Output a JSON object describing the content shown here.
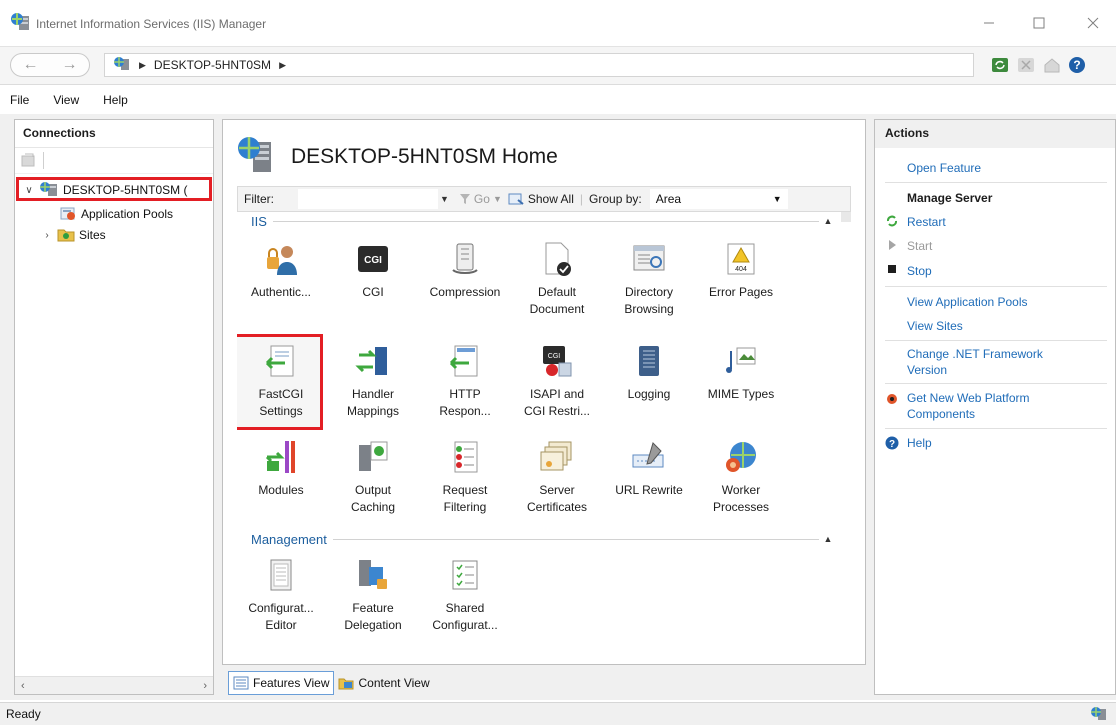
{
  "window": {
    "title": "Internet Information Services (IIS) Manager"
  },
  "address_bar": {
    "crumbs": [
      "DESKTOP-5HNT0SM"
    ]
  },
  "menu": [
    "File",
    "View",
    "Help"
  ],
  "connections": {
    "header": "Connections",
    "tree": [
      {
        "label": "DESKTOP-5HNT0SM (",
        "expanded": true,
        "icon": "server-icon"
      },
      {
        "label": "Application Pools",
        "icon": "app-pools-icon"
      },
      {
        "label": "Sites",
        "expanded": false,
        "icon": "sites-icon"
      }
    ]
  },
  "home": {
    "title": "DESKTOP-5HNT0SM Home"
  },
  "filter": {
    "label": "Filter:",
    "go": "Go",
    "show_all": "Show All",
    "group_by": "Group by:",
    "group_value": "Area"
  },
  "groups": {
    "iis": "IIS",
    "management": "Management"
  },
  "features_iis": [
    [
      "Authentic...",
      "CGI",
      "Compression",
      "Default\nDocument",
      "Directory\nBrowsing",
      "Error Pages"
    ],
    [
      "FastCGI\nSettings",
      "Handler\nMappings",
      "HTTP\nRespon...",
      "ISAPI and\nCGI Restri...",
      "Logging",
      "MIME Types"
    ],
    [
      "Modules",
      "Output\nCaching",
      "Request\nFiltering",
      "Server\nCertificates",
      "URL Rewrite",
      "Worker\nProcesses"
    ]
  ],
  "features_management": [
    "Configurat...\nEditor",
    "Feature\nDelegation",
    "Shared\nConfigurat..."
  ],
  "view_tabs": [
    "Features View",
    "Content View"
  ],
  "actions": {
    "header": "Actions",
    "open_feature": "Open Feature",
    "manage_server": "Manage Server",
    "restart": "Restart",
    "start": "Start",
    "stop": "Stop",
    "view_app_pools": "View Application Pools",
    "view_sites": "View Sites",
    "change_net": "Change .NET Framework\nVersion",
    "get_platform": "Get New Web Platform\nComponents",
    "help": "Help"
  },
  "status": "Ready",
  "colors": {
    "highlight": "#e31e24",
    "link": "#1f6cb8",
    "group": "#1c5e9e"
  }
}
